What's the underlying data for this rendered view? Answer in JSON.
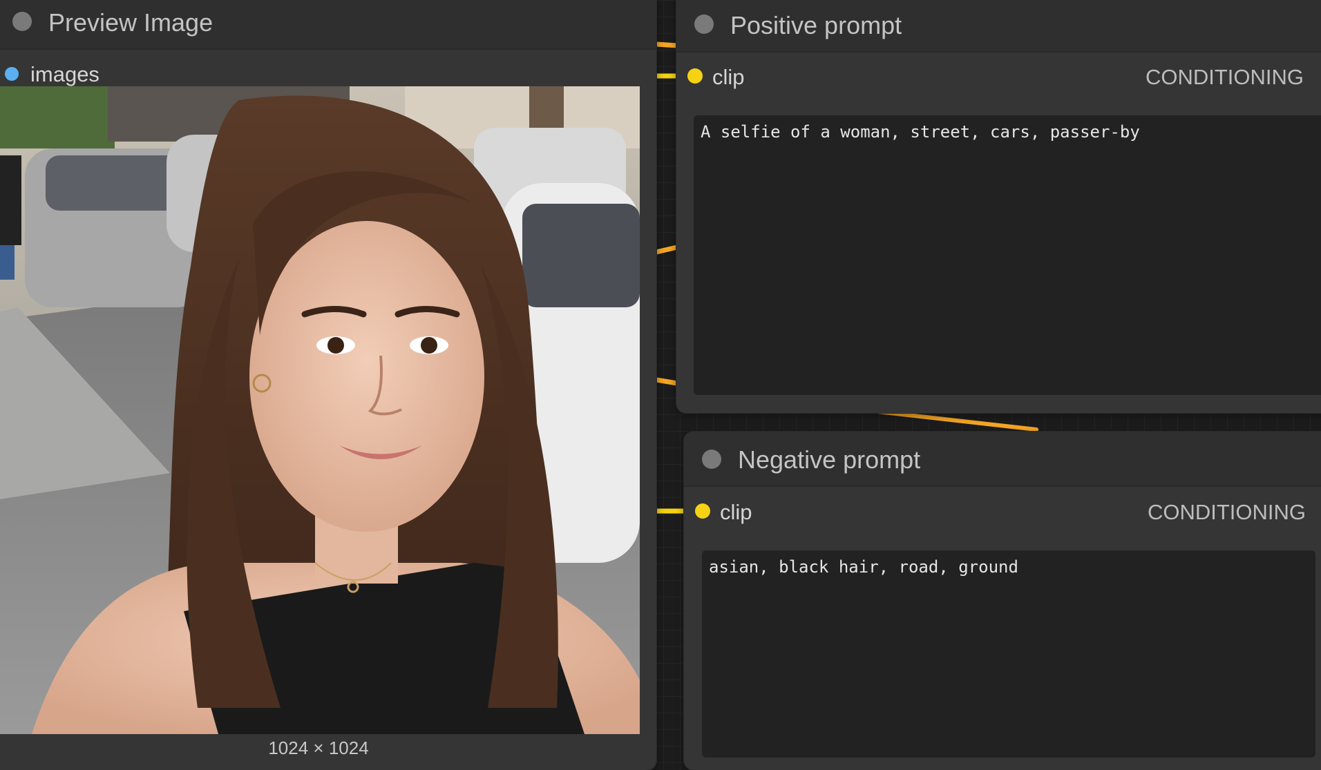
{
  "preview_node": {
    "title": "Preview Image",
    "input_label": "images",
    "image_dimensions": "1024 × 1024",
    "input_color": "#5ab0f0"
  },
  "positive_node": {
    "title": "Positive prompt",
    "input_label": "clip",
    "output_label": "CONDITIONING",
    "text": "A selfie of a woman, street, cars, passer-by",
    "input_color": "#f5d214",
    "output_color": "#f5a623"
  },
  "negative_node": {
    "title": "Negative prompt",
    "input_label": "clip",
    "output_label": "CONDITIONING",
    "text": "asian, black hair, road, ground",
    "input_color": "#f5d214",
    "output_color": "#f5a623"
  },
  "icons": {
    "node_status": "circle-icon",
    "slot": "dot-icon"
  }
}
